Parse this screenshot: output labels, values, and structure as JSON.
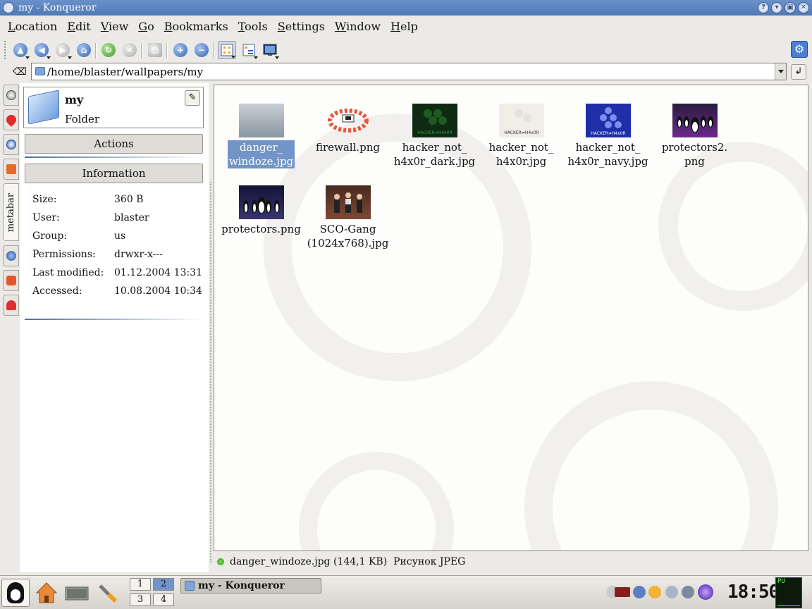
{
  "window": {
    "title": "my - Konqueror",
    "buttons": [
      "?",
      "▾",
      "▣",
      "✕"
    ]
  },
  "menu": {
    "items": [
      {
        "first": "L",
        "rest": "ocation"
      },
      {
        "first": "E",
        "rest": "dit"
      },
      {
        "first": "V",
        "rest": "iew"
      },
      {
        "first": "G",
        "rest": "o"
      },
      {
        "first": "B",
        "rest": "ookmarks"
      },
      {
        "first": "T",
        "rest": "ools"
      },
      {
        "first": "S",
        "rest": "ettings"
      },
      {
        "first": "W",
        "rest": "indow"
      },
      {
        "first": "H",
        "rest": "elp"
      }
    ]
  },
  "toolbar": {
    "icons": [
      "up-arrow-icon",
      "back-arrow-icon",
      "forward-arrow-icon",
      "home-icon",
      "reload-icon",
      "stop-icon",
      "print-icon",
      "zoom-in-icon",
      "zoom-out-icon",
      "icon-view-icon",
      "tree-view-icon",
      "image-preview-icon"
    ],
    "glyphs": {
      "up": "▲",
      "back": "◀",
      "forward": "▶",
      "home": "⌂",
      "reload": "↻",
      "stop": "✕",
      "print": "⎙",
      "zoom_in": "+",
      "zoom_out": "−"
    }
  },
  "location": {
    "clear_glyph": "⌫",
    "path": "/home/blaster/wallpapers/my",
    "go_glyph": "↲"
  },
  "metabar": {
    "tab_label": "metabar",
    "folder_name": "my",
    "folder_type": "Folder",
    "config_glyph": "✎",
    "actions_label": "Actions",
    "information_label": "Information",
    "info": [
      {
        "key": "Size:",
        "value": "360 B"
      },
      {
        "key": "User:",
        "value": "blaster"
      },
      {
        "key": "Group:",
        "value": "us"
      },
      {
        "key": "Permissions:",
        "value": "drwxr-x---"
      },
      {
        "key": "Last modified:",
        "value": "01.12.2004 13:31"
      },
      {
        "key": "Accessed:",
        "value": "10.08.2004 10:34"
      }
    ]
  },
  "files": [
    {
      "line1": "danger_",
      "line2": "windoze.jpg",
      "selected": true,
      "thumb_color": "#8a96a0"
    },
    {
      "line1": "firewall.png",
      "line2": "",
      "selected": false,
      "thumb_color": "#e8563a"
    },
    {
      "line1": "hacker_not_",
      "line2": "h4x0r_dark.jpg",
      "selected": false,
      "thumb_color": "#0e2a12",
      "thumb_text": "HACKER≠H4x0R"
    },
    {
      "line1": "hacker_not_",
      "line2": "h4x0r.jpg",
      "selected": false,
      "thumb_color": "#f1eee8",
      "thumb_text": "HACKER≠H4x0R"
    },
    {
      "line1": "hacker_not_",
      "line2": "h4x0r_navy.jpg",
      "selected": false,
      "thumb_color": "#1f2fa8",
      "thumb_text": "HACKER≠H4x0R"
    },
    {
      "line1": "protectors2.",
      "line2": "png",
      "selected": false,
      "thumb_color": "#6b2a8a"
    },
    {
      "line1": "protectors.png",
      "line2": "",
      "selected": false,
      "thumb_color": "#24224a"
    },
    {
      "line1": "SCO-Gang",
      "line2": "(1024x768).jpg",
      "selected": false,
      "thumb_color": "#6a3d2e"
    }
  ],
  "status": {
    "text": "danger_windoze.jpg (144,1 KB)  Рисунок JPEG"
  },
  "taskbar": {
    "pager": [
      "1",
      "2",
      "3",
      "4"
    ],
    "active_desktop": "2",
    "task_label": "my - Konqueror",
    "clock": "18:50",
    "sysmon_label": "PU"
  },
  "colors": {
    "titlebar": "#5a82bf",
    "selection": "#7394c7",
    "accent": "#4a7fd2"
  }
}
